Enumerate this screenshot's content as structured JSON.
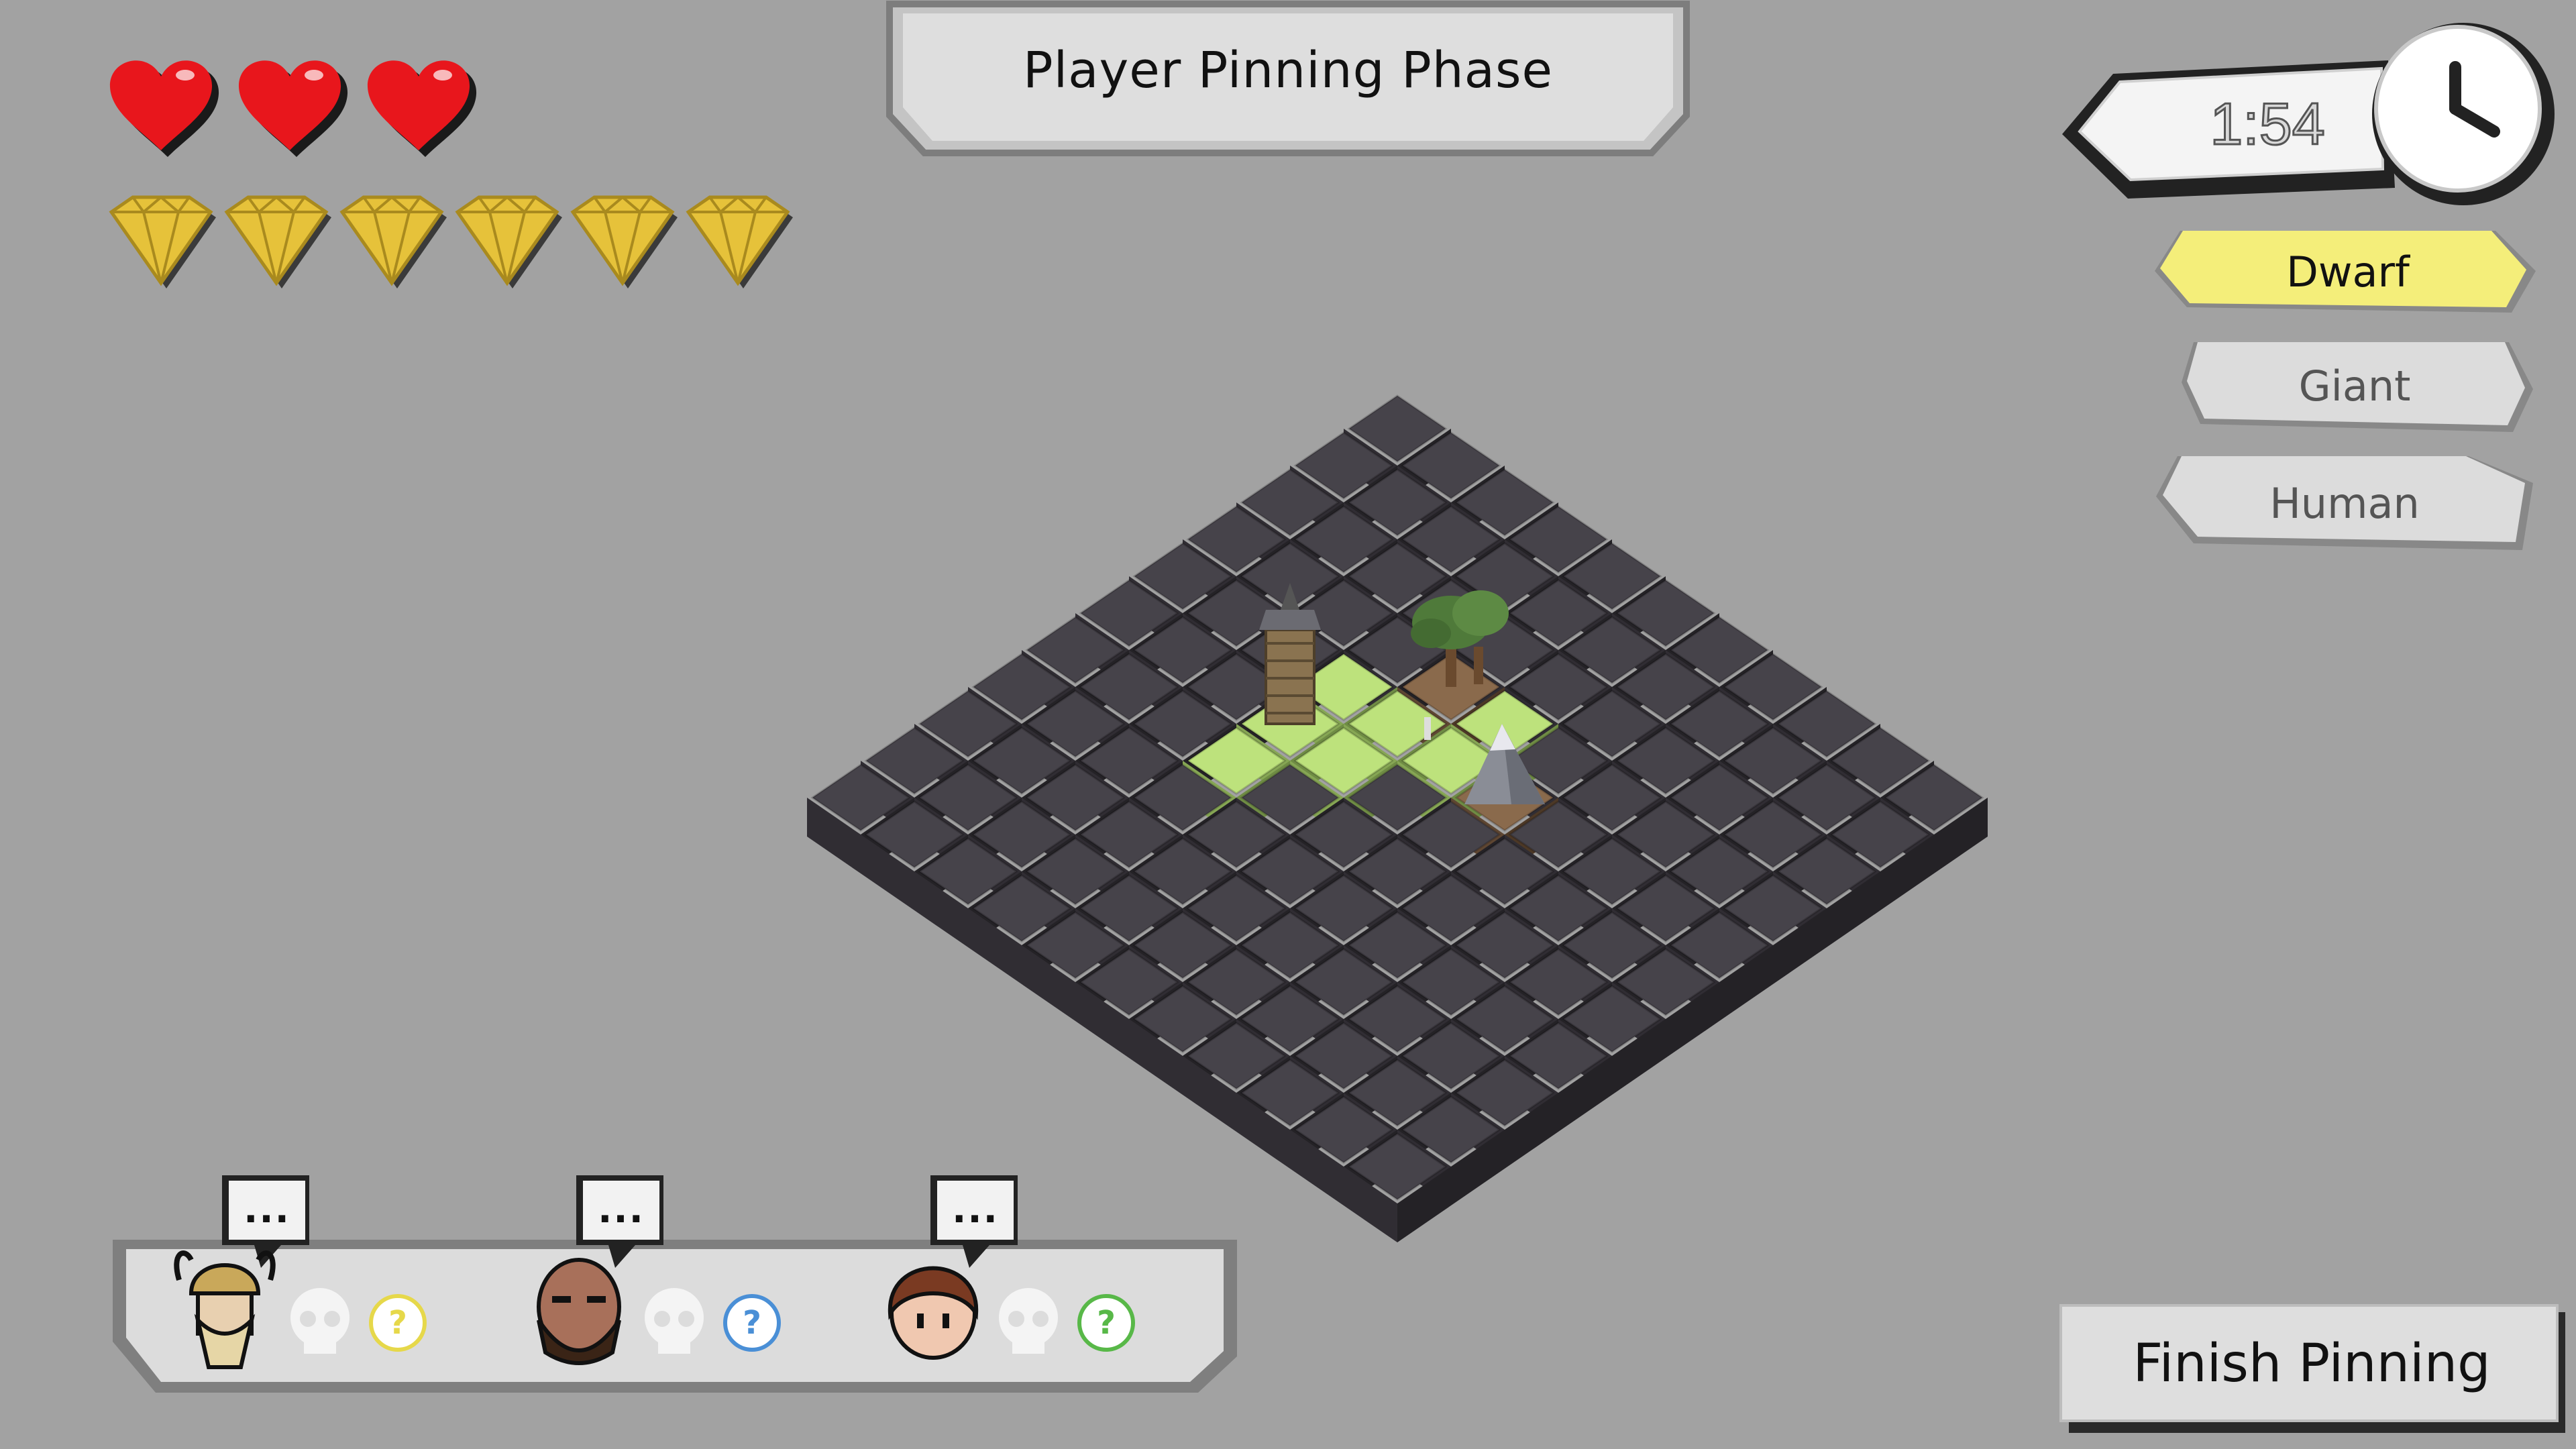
{
  "phase": {
    "title": "Player Pinning Phase"
  },
  "timer": {
    "time": "1:54"
  },
  "resources": {
    "hearts": 3,
    "gems": 6,
    "heart_color": "#e8161c",
    "gem_color": "#e6c23a"
  },
  "races": [
    {
      "label": "Dwarf",
      "selected": true,
      "color": "#f4ee7a"
    },
    {
      "label": "Giant",
      "selected": false,
      "color": "#dcdcdc"
    },
    {
      "label": "Human",
      "selected": false,
      "color": "#dcdcdc"
    }
  ],
  "players": [
    {
      "portrait": "viking-dwarf-icon",
      "bubble": "...",
      "status": "?",
      "status_color": "#e6d84a"
    },
    {
      "portrait": "bearded-giant-icon",
      "bubble": "...",
      "status": "?",
      "status_color": "#4a8fd6"
    },
    {
      "portrait": "human-face-icon",
      "bubble": "...",
      "status": "?",
      "status_color": "#58b848"
    }
  ],
  "actions": {
    "finish_label": "Finish Pinning"
  },
  "colors": {
    "background": "#a2a2a2",
    "tile": "#46434a",
    "highlight": "#bde27c"
  }
}
